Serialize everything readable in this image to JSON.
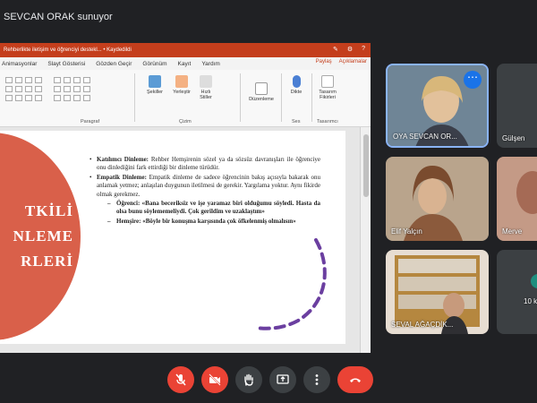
{
  "meeting": {
    "presenter_label": "SEVCAN ORAK sunuyor"
  },
  "ppt": {
    "file_title": "Rehberlikte iletişim ve öğrenciyi destekl... • Kaydedildi",
    "menu": [
      "Animasyonlar",
      "Slayt Gösterisi",
      "Gözden Geçir",
      "Görünüm",
      "Kayıt",
      "Yardım"
    ],
    "share_label": "Paylaş",
    "comments_label": "Açıklamalar",
    "ribbon": {
      "paragraph_group": "Paragraf",
      "shapes": "Şekiller",
      "arrange": "Yerleştir",
      "quick_styles": "Hızlı Stiller",
      "drawing_group": "Çizim",
      "editing": "Düzenleme",
      "dictate": "Dikte",
      "voice_group": "Ses",
      "designer": "Tasarım Fikirleri",
      "designer_group": "Tasarımcı"
    },
    "slide": {
      "circle_lines": [
        "TKİLİ",
        "NLEME",
        "RLERİ"
      ],
      "items": [
        {
          "bold": "Katılımcı Dinleme:",
          "text": " Rehber Hemşirenin sözel ya da sözsüz davranışları ile öğrenciye onu dinlediğini fark ettirdiği bir dinleme türüdür."
        },
        {
          "bold": "Empatik Dinleme:",
          "text": " Empatik dinleme de sadece öğrencinin bakış açısıyla bakarak onu anlamak yetmez; anlaşılan duygunun iletilmesi de gerekir. Yargılama yoktur. Aynı fikirde olmak gerekmez."
        }
      ],
      "subitems": [
        "Öğrenci: «Bana beceriksiz ve işe yaramaz biri olduğumu söyledi. Hasta da olsa bunu söylememeliydi. Çok gerildim ve uzaklaştım»",
        "Hemşire: «Böyle bir konuşma karşısında çok öfkelenmiş olmalısın»"
      ]
    }
  },
  "participants": [
    {
      "name": "OYA SEVCAN OR..."
    },
    {
      "name": "Gülşen"
    },
    {
      "name": "Elif Yalçın"
    },
    {
      "name": "Merve"
    },
    {
      "name": "SEVAL AĞAÇDİK..."
    },
    {
      "name": "10 k"
    }
  ],
  "colors": {
    "accent": "#1a73e8",
    "ppt_red": "#c43e1c",
    "slide_circle": "#d9604a",
    "end_call": "#ea4335"
  }
}
